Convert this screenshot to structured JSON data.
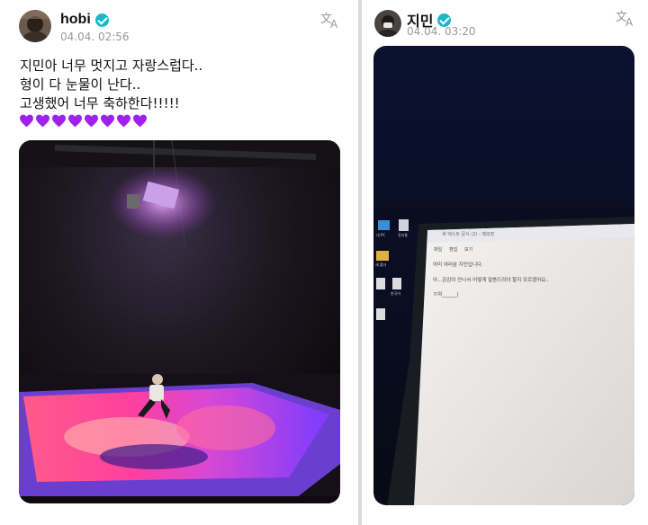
{
  "left_post": {
    "username": "hobi",
    "timestamp": "04.04. 02:56",
    "lines": [
      "지민아 너무 멋지고 자랑스럽다..",
      "형이 다 눈물이 난다..",
      "고생했어 너무 축하한다!!!!!"
    ],
    "heart_count": 8,
    "heart_color": "#a020f0"
  },
  "right_post": {
    "username": "지민",
    "timestamp": "04.04. 03:20",
    "laptop": {
      "window_title": "새 텍스트 문서 (2) - 메모장",
      "menu": [
        "파일",
        "편집",
        "보기"
      ],
      "note_lines": [
        "아미 여러분 지민입니다.",
        "아...감감이 안나서 어떻게 말씀드려야 할지 모르겠어요..",
        "ㅎ여______|"
      ],
      "desktop_icons": [
        "내 PC",
        "휴지통",
        "새 폴더",
        "",
        "한국어",
        ""
      ]
    }
  },
  "colors": {
    "verified": "#19b8c8",
    "timestamp": "#999999",
    "background": "#d9d9d9"
  }
}
